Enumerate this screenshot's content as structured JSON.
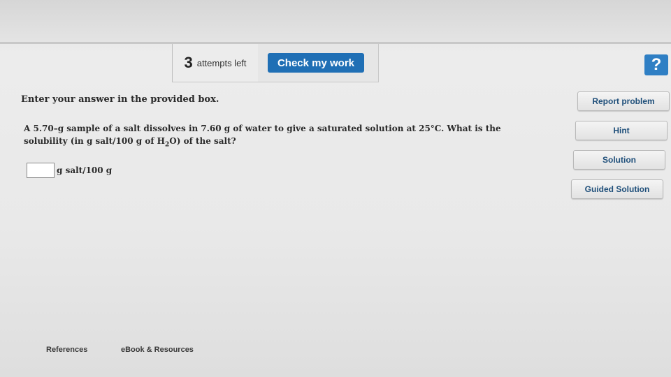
{
  "toolbar": {
    "attempts_count": "3",
    "attempts_label": "attempts left",
    "check_label": "Check my work",
    "help_label": "?"
  },
  "instructions": "Enter your answer in the provided box.",
  "question": {
    "part1": "A 5.70–g sample of a salt dissolves in 7.60 g of water to give a saturated solution at 25°C. What is the solubility (in g salt/100 g of H",
    "subscript": "2",
    "part2": "O) of the salt?"
  },
  "answer": {
    "value": "",
    "unit": "g salt/100 g"
  },
  "side_buttons": {
    "report": "Report problem",
    "hint": "Hint",
    "solution": "Solution",
    "guided": "Guided Solution"
  },
  "footer": {
    "references": "References",
    "ebook": "eBook & Resources"
  },
  "colors": {
    "primary_button": "#1f6fb5",
    "help_button": "#2f7fc4"
  }
}
